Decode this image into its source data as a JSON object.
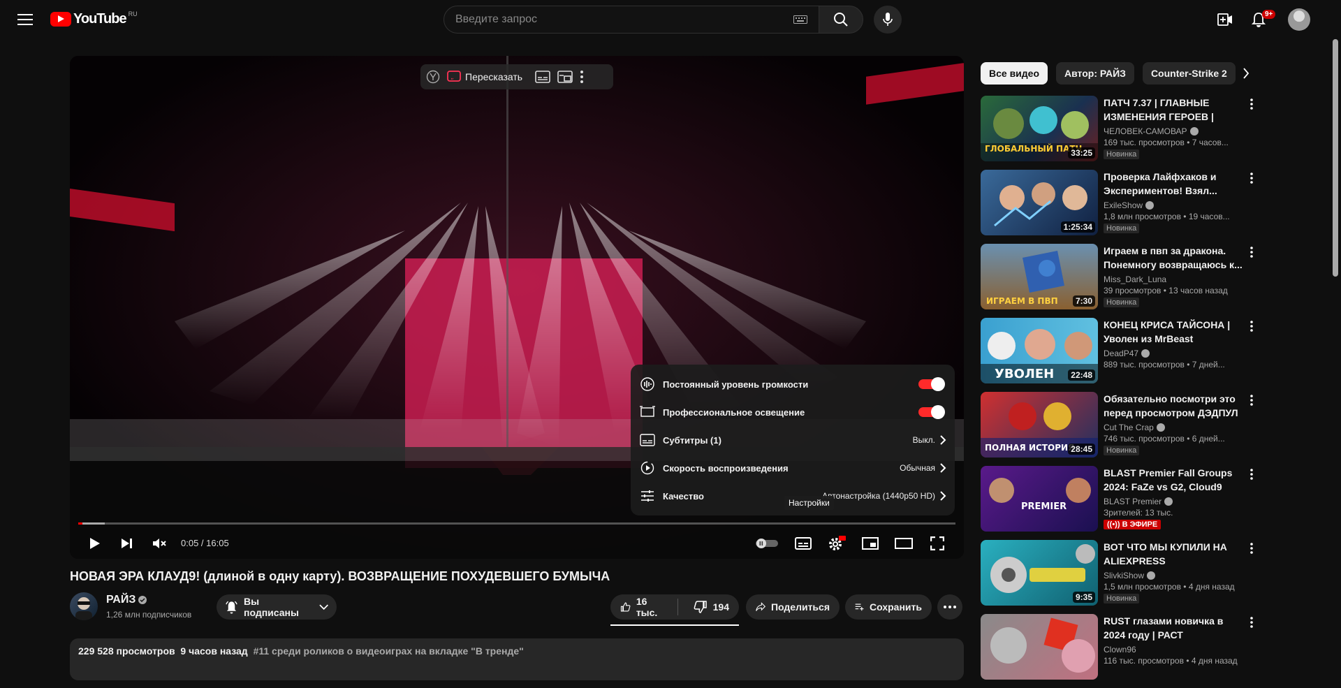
{
  "header": {
    "logo_text": "YouTube",
    "region": "RU",
    "search_placeholder": "Введите запрос",
    "notifications_badge": "9+"
  },
  "player": {
    "overlay": {
      "retell_label": "Пересказать"
    },
    "settings": [
      {
        "label": "Постоянный уровень громкости",
        "value": "",
        "type": "toggle",
        "on": true,
        "icon": "volume-level-icon"
      },
      {
        "label": "Профессиональное освещение",
        "value": "",
        "type": "toggle",
        "on": true,
        "icon": "ambient-light-icon"
      },
      {
        "label": "Субтитры (1)",
        "value": "Выкл.",
        "type": "menu",
        "icon": "subtitles-icon"
      },
      {
        "label": "Скорость воспроизведения",
        "value": "Обычная",
        "type": "menu",
        "icon": "playback-speed-icon"
      },
      {
        "label": "Качество",
        "value": "Автонастройка (1440p50 HD)",
        "type": "menu",
        "icon": "quality-icon"
      }
    ],
    "time": "0:05 / 16:05",
    "progress_fraction": 0.005,
    "loaded_fraction": 0.03,
    "settings_tooltip": "Настройки",
    "accent_color": "#ff0000"
  },
  "video": {
    "title": "НОВАЯ ЭРА КЛАУД9! (длиной в одну карту). ВОЗВРАЩЕНИЕ ПОХУДЕВШЕГО БУМЫЧА",
    "channel_name": "РАЙЗ",
    "subscribers": "1,26 млн подписчиков",
    "subscribe_label": "Вы подписаны",
    "likes": "16 тыс.",
    "dislikes": "194",
    "share_label": "Поделиться",
    "save_label": "Сохранить",
    "views": "229 528 просмотров",
    "published": "9 часов назад",
    "trending": "#11 среди роликов о видеоиграх на вкладке \"В тренде\""
  },
  "sidebar": {
    "chips": [
      "Все видео",
      "Автор: РАЙЗ",
      "Counter-Strike 2"
    ],
    "recommendations": [
      {
        "title": "ПАТЧ 7.37 | ГЛАВНЫЕ ИЗМЕНЕНИЯ ГЕРОЕВ | НОВЫ...",
        "channel": "ЧЕЛОВЕК-САМОВАР",
        "meta": "169 тыс. просмотров • 7 часов...",
        "duration": "33:25",
        "badge": "Новинка",
        "thumb_text": "ГЛОБАЛЬНЫЙ ПАТЧ"
      },
      {
        "title": "Проверка Лайфхаков и Экспериментов! Взял...",
        "channel": "ExileShow",
        "meta": "1,8 млн просмотров • 19 часов...",
        "duration": "1:25:34",
        "badge": "Новинка",
        "thumb_text": ""
      },
      {
        "title": "Играем в пвп за дракона. Понемногу возвращаюсь к...",
        "channel": "Miss_Dark_Luna",
        "meta": "39 просмотров • 13 часов назад",
        "duration": "7:30",
        "badge": "Новинка",
        "thumb_text": "ИГРАЕМ В ПВП"
      },
      {
        "title": "КОНЕЦ КРИСА ТАЙСОНА | Уволен из MrBeast",
        "channel": "DeadP47",
        "meta": "889 тыс. просмотров • 7 дней...",
        "duration": "22:48",
        "badge": "",
        "thumb_text": "УВОЛЕН"
      },
      {
        "title": "Обязательно посмотри это перед просмотром ДЭДПУЛ ...",
        "channel": "Cut The Crap",
        "meta": "746 тыс. просмотров • 6 дней...",
        "duration": "28:45",
        "badge": "Новинка",
        "thumb_text": "ПОЛНАЯ ИСТОРИЯ"
      },
      {
        "title": "BLAST Premier Fall Groups 2024: FaZe vs G2, Cloud9 vs...",
        "channel": "BLAST Premier",
        "meta": "Зрителей: 13 тыс.",
        "duration": "",
        "badge": "",
        "live": "В ЭФИРЕ",
        "thumb_text": "PREMIER"
      },
      {
        "title": "ВОТ ЧТО МЫ КУПИЛИ НА ALIEXPRESS",
        "channel": "SlivkiShow",
        "meta": "1,5 млн просмотров • 4 дня назад",
        "duration": "9:35",
        "badge": "Новинка",
        "thumb_text": ""
      },
      {
        "title": "RUST глазами новичка в 2024 году | РАСТ",
        "channel": "Clown96",
        "meta": "116 тыс. просмотров • 4 дня назад",
        "duration": "",
        "badge": "",
        "thumb_text": ""
      }
    ]
  }
}
